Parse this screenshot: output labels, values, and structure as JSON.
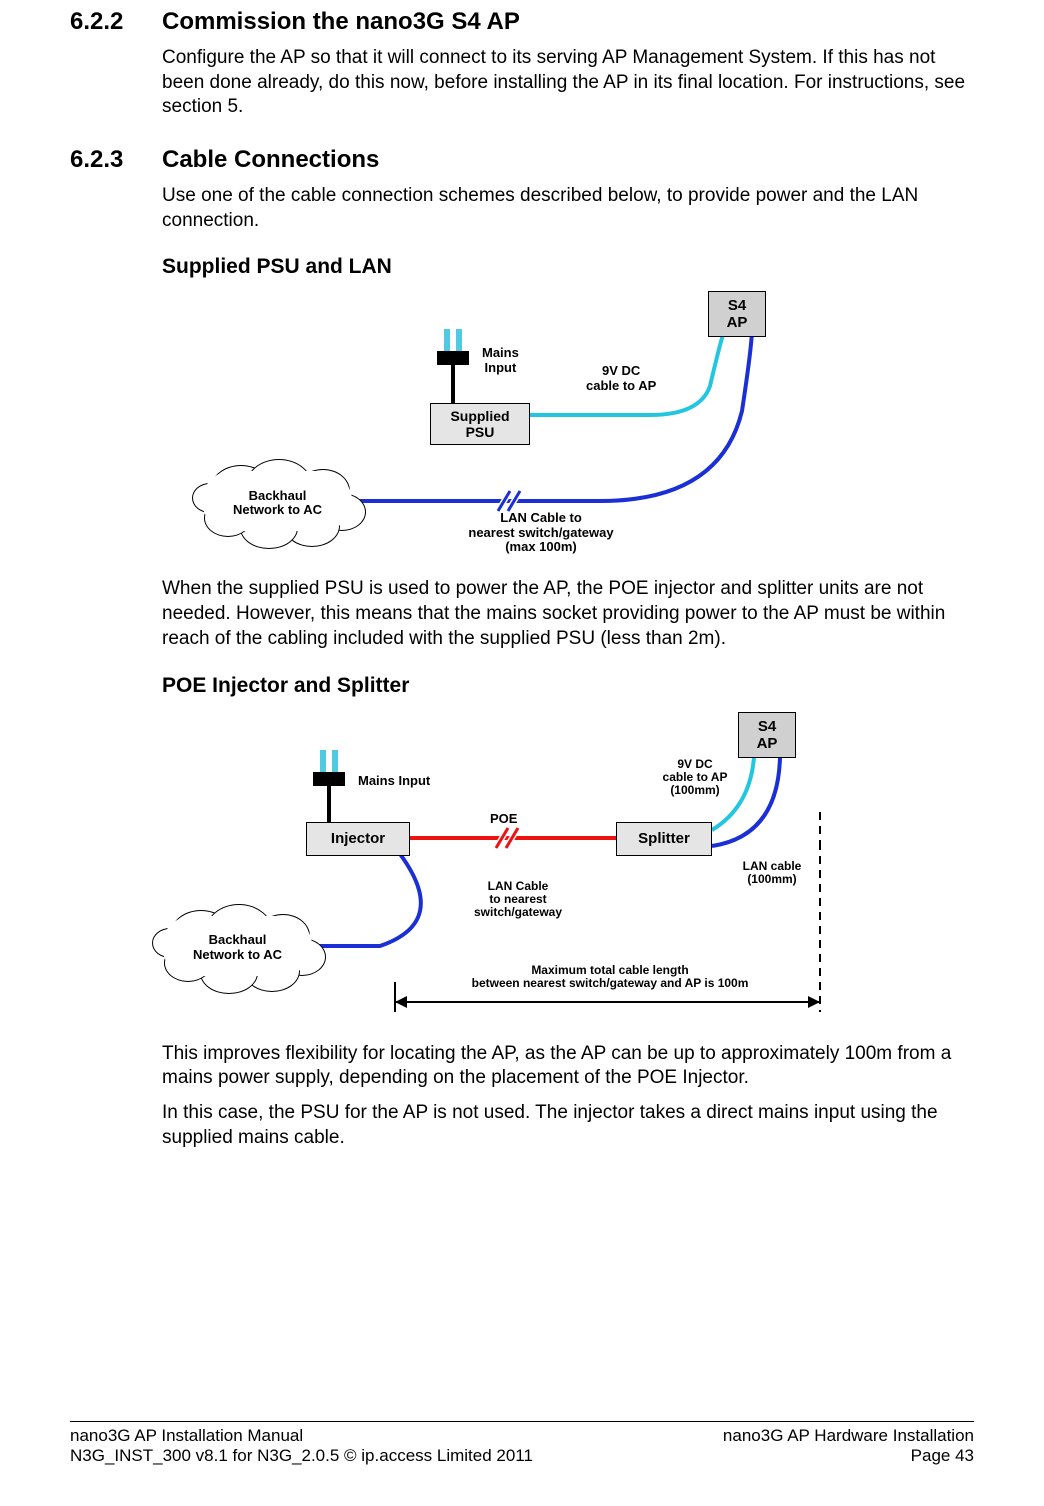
{
  "sections": {
    "s1_num": "6.2.2",
    "s1_title": "Commission the nano3G S4 AP",
    "s1_body": "Configure the AP so that it will connect to its serving AP Management System. If this has not been done already, do this now, before installing the AP in its final location. For instructions, see section 5.",
    "s2_num": "6.2.3",
    "s2_title": "Cable Connections",
    "s2_body": "Use one of the cable connection schemes described below, to provide power and the LAN connection.",
    "sub1": "Supplied PSU and LAN",
    "sub1_after": "When the supplied PSU is used to power the AP, the POE injector and splitter units are not needed. However, this means that the mains socket providing power to the AP must be within reach of the cabling included with the supplied PSU (less than 2m).",
    "sub2": "POE Injector and Splitter",
    "sub2_after_a": "This improves flexibility for locating the AP, as the AP can be up to approximately 100m from a mains power supply, depending on the placement of the POE Injector.",
    "sub2_after_b": "In this case, the PSU for the AP is not used. The injector takes a direct mains input using the supplied mains cable."
  },
  "diagram1": {
    "cloud": "Backhaul\nNetwork to AC",
    "mains": "Mains\nInput",
    "psu": "Supplied\nPSU",
    "s4ap": "S4\nAP",
    "dc": "9V DC\ncable to AP",
    "lan": "LAN Cable to\nnearest switch/gateway\n(max 100m)"
  },
  "diagram2": {
    "cloud": "Backhaul\nNetwork to AC",
    "mains": "Mains Input",
    "injector": "Injector",
    "splitter": "Splitter",
    "s4ap": "S4\nAP",
    "poe": "POE",
    "dc": "9V DC\ncable to AP\n(100mm)",
    "lan_short": "LAN cable\n(100mm)",
    "lan_sw": "LAN Cable\nto nearest\nswitch/gateway",
    "maxlen": "Maximum total cable length\nbetween nearest switch/gateway and AP is 100m"
  },
  "footer": {
    "left1": "nano3G AP Installation Manual",
    "left2": "N3G_INST_300 v8.1 for N3G_2.0.5 © ip.access Limited 2011",
    "right1": "nano3G AP Hardware Installation",
    "right2": "Page 43"
  }
}
